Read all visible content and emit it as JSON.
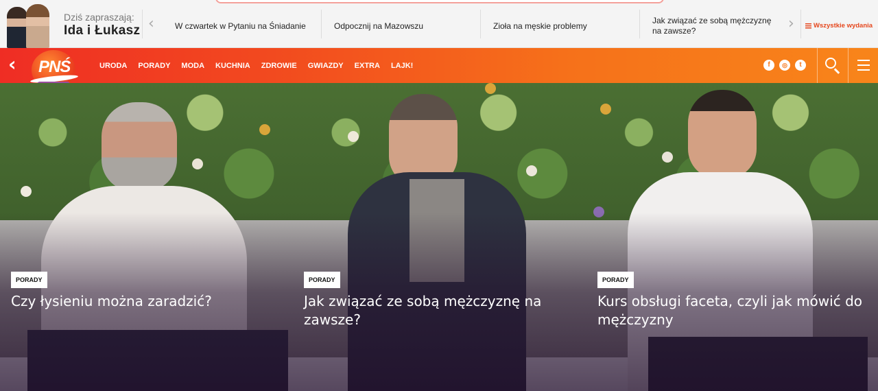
{
  "hosts": {
    "label": "Dziś zapraszają:",
    "names": "Ida i Łukasz"
  },
  "topics": [
    {
      "label": "W czwartek w Pytaniu na Śniadanie"
    },
    {
      "label": "Odpocznij na Mazowszu"
    },
    {
      "label": "Zioła na męskie problemy"
    },
    {
      "label": "Jak związać ze sobą mężczyznę na zawsze?"
    }
  ],
  "all_editions": "Wszystkie wydania",
  "logo": "PNŚ",
  "menu": [
    "URODA",
    "PORADY",
    "MODA",
    "KUCHNIA",
    "ZDROWIE",
    "GWIAZDY",
    "EXTRA",
    "LAJK!"
  ],
  "social": [
    {
      "icon": "facebook-icon",
      "glyph": "f"
    },
    {
      "icon": "instagram-icon",
      "glyph": "◎"
    },
    {
      "icon": "twitter-icon",
      "glyph": "t"
    }
  ],
  "colors": {
    "nav_start": "#ef2d24",
    "nav_end": "#f8851a",
    "accent": "#e5461c"
  },
  "cards": [
    {
      "category": "PORADY",
      "title": "Czy łysieniu można zaradzić?"
    },
    {
      "category": "PORADY",
      "title": "Jak związać ze sobą mężczyznę na zawsze?"
    },
    {
      "category": "PORADY",
      "title": "Kurs obsługi faceta, czyli jak mówić do mężczyzny"
    }
  ]
}
